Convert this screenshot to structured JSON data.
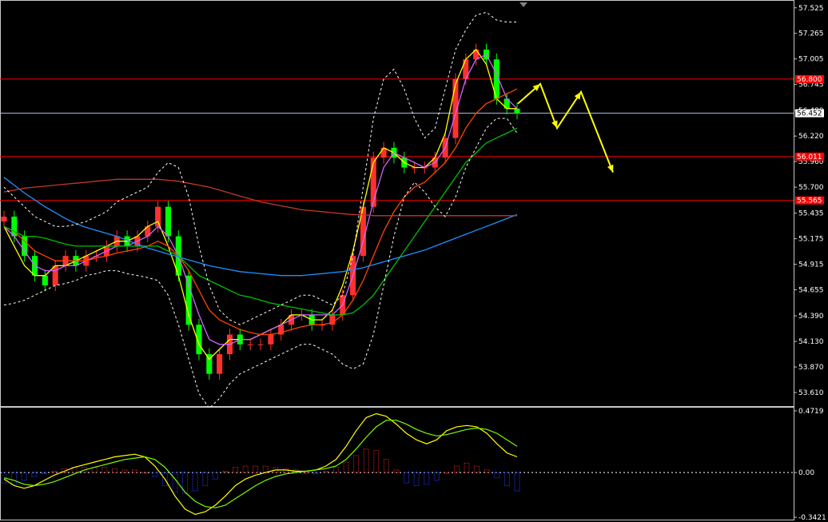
{
  "chart_data": [
    {
      "type": "candlestick",
      "panel": "price",
      "ylim": [
        53.48,
        57.58
      ],
      "y_ticks": [
        "57.525",
        "57.265",
        "57.005",
        "56.745",
        "56.480",
        "56.220",
        "55.960",
        "55.700",
        "55.435",
        "55.175",
        "54.915",
        "54.655",
        "54.390",
        "54.130",
        "53.870",
        "53.610"
      ],
      "current_price": "56.452",
      "levels": [
        {
          "label": "56.800",
          "value": 56.8,
          "color": "#ff0000"
        },
        {
          "label": "56.011",
          "value": 56.011,
          "color": "#ff0000"
        },
        {
          "label": "55.565",
          "value": 55.565,
          "color": "#ff0000"
        }
      ],
      "candle_colors": {
        "up": "#ff3030",
        "down": "#00ff00"
      },
      "close": [
        55.4,
        55.2,
        55.0,
        54.8,
        54.7,
        54.9,
        55.0,
        54.9,
        55.0,
        55.0,
        55.1,
        55.2,
        55.1,
        55.2,
        55.3,
        55.5,
        55.2,
        54.8,
        54.3,
        54.0,
        53.8,
        54.0,
        54.2,
        54.1,
        54.1,
        54.1,
        54.2,
        54.3,
        54.4,
        54.4,
        54.3,
        54.3,
        54.4,
        54.6,
        55.0,
        55.5,
        56.0,
        56.1,
        56.0,
        55.9,
        55.9,
        55.9,
        56.0,
        56.2,
        56.8,
        57.0,
        57.1,
        57.0,
        56.6,
        56.5,
        56.45
      ],
      "series": [
        {
          "name": "",
          "color": "#ffff00",
          "values": [
            55.3,
            55.1,
            54.9,
            54.8,
            54.8,
            54.9,
            54.9,
            54.95,
            55.0,
            55.05,
            55.1,
            55.15,
            55.15,
            55.2,
            55.3,
            55.35,
            55.1,
            54.8,
            54.4,
            54.1,
            53.95,
            54.05,
            54.15,
            54.15,
            54.15,
            54.2,
            54.25,
            54.3,
            54.4,
            54.4,
            54.35,
            54.35,
            54.45,
            54.7,
            55.05,
            55.5,
            55.95,
            56.1,
            56.05,
            55.95,
            55.9,
            55.9,
            56.0,
            56.25,
            56.75,
            57.0,
            57.1,
            56.95,
            56.6,
            56.5,
            56.5
          ]
        },
        {
          "name": "",
          "color": "#cc66ff",
          "values": [
            55.3,
            55.2,
            55.05,
            54.9,
            54.85,
            54.85,
            54.9,
            54.9,
            54.95,
            55.0,
            55.05,
            55.1,
            55.1,
            55.15,
            55.2,
            55.3,
            55.2,
            55.0,
            54.7,
            54.4,
            54.15,
            54.1,
            54.1,
            54.15,
            54.15,
            54.2,
            54.25,
            54.3,
            54.35,
            54.4,
            54.4,
            54.4,
            54.4,
            54.5,
            54.8,
            55.15,
            55.55,
            55.9,
            56.05,
            56.0,
            55.95,
            55.9,
            55.95,
            56.1,
            56.45,
            56.8,
            57.0,
            57.05,
            56.85,
            56.6,
            56.5
          ]
        },
        {
          "name": "",
          "color": "#ff4500",
          "values": [
            55.3,
            55.25,
            55.15,
            55.05,
            55.0,
            54.95,
            54.95,
            54.95,
            54.95,
            54.98,
            55.0,
            55.03,
            55.05,
            55.07,
            55.1,
            55.15,
            55.1,
            55.0,
            54.85,
            54.65,
            54.45,
            54.35,
            54.3,
            54.25,
            54.22,
            54.2,
            54.2,
            54.22,
            54.25,
            54.28,
            54.3,
            54.3,
            54.32,
            54.4,
            54.55,
            54.75,
            55.0,
            55.25,
            55.45,
            55.6,
            55.7,
            55.75,
            55.85,
            55.95,
            56.1,
            56.3,
            56.45,
            56.55,
            56.6,
            56.65,
            56.7
          ]
        },
        {
          "name": "",
          "color": "#00c000",
          "values": [
            55.3,
            55.25,
            55.2,
            55.2,
            55.18,
            55.15,
            55.12,
            55.1,
            55.1,
            55.1,
            55.1,
            55.1,
            55.1,
            55.1,
            55.1,
            55.1,
            55.05,
            55.0,
            54.9,
            54.8,
            54.75,
            54.7,
            54.65,
            54.6,
            54.58,
            54.55,
            54.52,
            54.5,
            54.48,
            54.46,
            54.44,
            54.42,
            54.4,
            54.4,
            54.42,
            54.5,
            54.6,
            54.75,
            54.9,
            55.05,
            55.2,
            55.35,
            55.5,
            55.65,
            55.8,
            55.95,
            56.05,
            56.15,
            56.2,
            56.25,
            56.3
          ]
        },
        {
          "name": "",
          "color": "#1e90ff",
          "values": [
            55.8,
            55.72,
            55.64,
            55.57,
            55.5,
            55.44,
            55.38,
            55.33,
            55.29,
            55.26,
            55.23,
            55.2,
            55.16,
            55.12,
            55.08,
            55.05,
            55.02,
            54.99,
            54.96,
            54.93,
            54.9,
            54.88,
            54.86,
            54.84,
            54.83,
            54.82,
            54.81,
            54.8,
            54.8,
            54.8,
            54.81,
            54.82,
            54.83,
            54.84,
            54.86,
            54.88,
            54.91,
            54.94,
            54.97,
            55.0,
            55.03,
            55.06,
            55.1,
            55.14,
            55.18,
            55.22,
            55.26,
            55.3,
            55.34,
            55.38,
            55.42
          ]
        },
        {
          "name": "",
          "color": "#c0392b",
          "values": [
            55.65,
            55.67,
            55.69,
            55.7,
            55.71,
            55.72,
            55.73,
            55.74,
            55.75,
            55.76,
            55.77,
            55.78,
            55.78,
            55.78,
            55.78,
            55.78,
            55.77,
            55.76,
            55.74,
            55.72,
            55.7,
            55.67,
            55.64,
            55.61,
            55.58,
            55.55,
            55.53,
            55.51,
            55.49,
            55.47,
            55.46,
            55.45,
            55.44,
            55.43,
            55.42,
            55.42,
            55.41,
            55.41,
            55.41,
            55.41,
            55.41,
            55.41,
            55.41,
            55.41,
            55.41,
            55.41,
            55.41,
            55.41,
            55.41,
            55.41,
            55.41
          ]
        },
        {
          "name": "",
          "color": "#ffffff",
          "dashed": true,
          "values": [
            55.7,
            55.6,
            55.5,
            55.4,
            55.35,
            55.3,
            55.3,
            55.32,
            55.35,
            55.4,
            55.45,
            55.55,
            55.6,
            55.65,
            55.7,
            55.85,
            55.95,
            55.9,
            55.6,
            55.1,
            54.7,
            54.45,
            54.35,
            54.3,
            54.35,
            54.4,
            54.45,
            54.5,
            54.55,
            54.6,
            54.6,
            54.55,
            54.5,
            54.6,
            55.0,
            55.7,
            56.4,
            56.8,
            56.9,
            56.7,
            56.4,
            56.2,
            56.3,
            56.7,
            57.1,
            57.3,
            57.45,
            57.48,
            57.4,
            57.38,
            57.38
          ]
        },
        {
          "name": "",
          "color": "#ffffff",
          "dashed": true,
          "values": [
            54.5,
            54.52,
            54.55,
            54.6,
            54.65,
            54.7,
            54.72,
            54.75,
            54.8,
            54.82,
            54.85,
            54.85,
            54.82,
            54.8,
            54.78,
            54.75,
            54.6,
            54.3,
            53.95,
            53.6,
            53.45,
            53.55,
            53.7,
            53.8,
            53.85,
            53.9,
            53.95,
            54.0,
            54.05,
            54.1,
            54.1,
            54.05,
            54.0,
            53.9,
            53.85,
            53.9,
            54.2,
            54.7,
            55.2,
            55.6,
            55.75,
            55.65,
            55.5,
            55.4,
            55.6,
            55.9,
            56.1,
            56.3,
            56.4,
            56.4,
            56.25
          ]
        }
      ],
      "forecast": {
        "color": "#ffff00",
        "values": [
          56.55,
          56.75,
          56.3,
          56.67,
          55.85
        ]
      }
    },
    {
      "type": "bar",
      "panel": "oscillator",
      "ylim": [
        -0.36,
        0.49
      ],
      "y_ticks": [
        "0.4719",
        "0.00",
        "-0.3421"
      ],
      "bar_colors": {
        "positive": "#e02020",
        "negative": "#2040ff"
      },
      "values": [
        -0.08,
        -0.09,
        -0.06,
        -0.03,
        -0.01,
        0.01,
        0.03,
        0.04,
        0.04,
        0.04,
        0.04,
        0.03,
        0.02,
        0.02,
        0.0,
        -0.03,
        -0.1,
        -0.15,
        -0.16,
        -0.14,
        -0.1,
        -0.05,
        0.01,
        0.04,
        0.05,
        0.05,
        0.05,
        0.04,
        0.03,
        0.02,
        0.0,
        -0.01,
        0.01,
        0.04,
        0.08,
        0.13,
        0.18,
        0.17,
        0.1,
        0.02,
        -0.08,
        -0.1,
        -0.09,
        -0.06,
        0.0,
        0.05,
        0.07,
        0.05,
        0.02,
        -0.04,
        -0.1,
        -0.14
      ],
      "series": [
        {
          "name": "",
          "color": "#ffff00",
          "values": [
            -0.05,
            -0.1,
            -0.12,
            -0.1,
            -0.06,
            -0.02,
            0.01,
            0.04,
            0.06,
            0.08,
            0.1,
            0.12,
            0.13,
            0.14,
            0.12,
            0.05,
            -0.05,
            -0.18,
            -0.28,
            -0.32,
            -0.3,
            -0.25,
            -0.18,
            -0.1,
            -0.05,
            -0.02,
            0.0,
            0.02,
            0.02,
            0.01,
            0.01,
            0.02,
            0.05,
            0.1,
            0.2,
            0.32,
            0.42,
            0.45,
            0.43,
            0.37,
            0.3,
            0.25,
            0.22,
            0.25,
            0.32,
            0.35,
            0.36,
            0.35,
            0.3,
            0.22,
            0.15,
            0.12
          ]
        },
        {
          "name": "",
          "color": "#7cfc00",
          "values": [
            -0.04,
            -0.06,
            -0.09,
            -0.1,
            -0.09,
            -0.07,
            -0.04,
            -0.01,
            0.02,
            0.04,
            0.06,
            0.08,
            0.1,
            0.11,
            0.12,
            0.1,
            0.04,
            -0.05,
            -0.15,
            -0.22,
            -0.26,
            -0.27,
            -0.25,
            -0.2,
            -0.15,
            -0.1,
            -0.06,
            -0.03,
            -0.01,
            0.0,
            0.01,
            0.02,
            0.03,
            0.05,
            0.1,
            0.18,
            0.27,
            0.35,
            0.4,
            0.4,
            0.37,
            0.33,
            0.3,
            0.28,
            0.29,
            0.31,
            0.33,
            0.34,
            0.33,
            0.3,
            0.25,
            0.2
          ]
        }
      ]
    }
  ]
}
